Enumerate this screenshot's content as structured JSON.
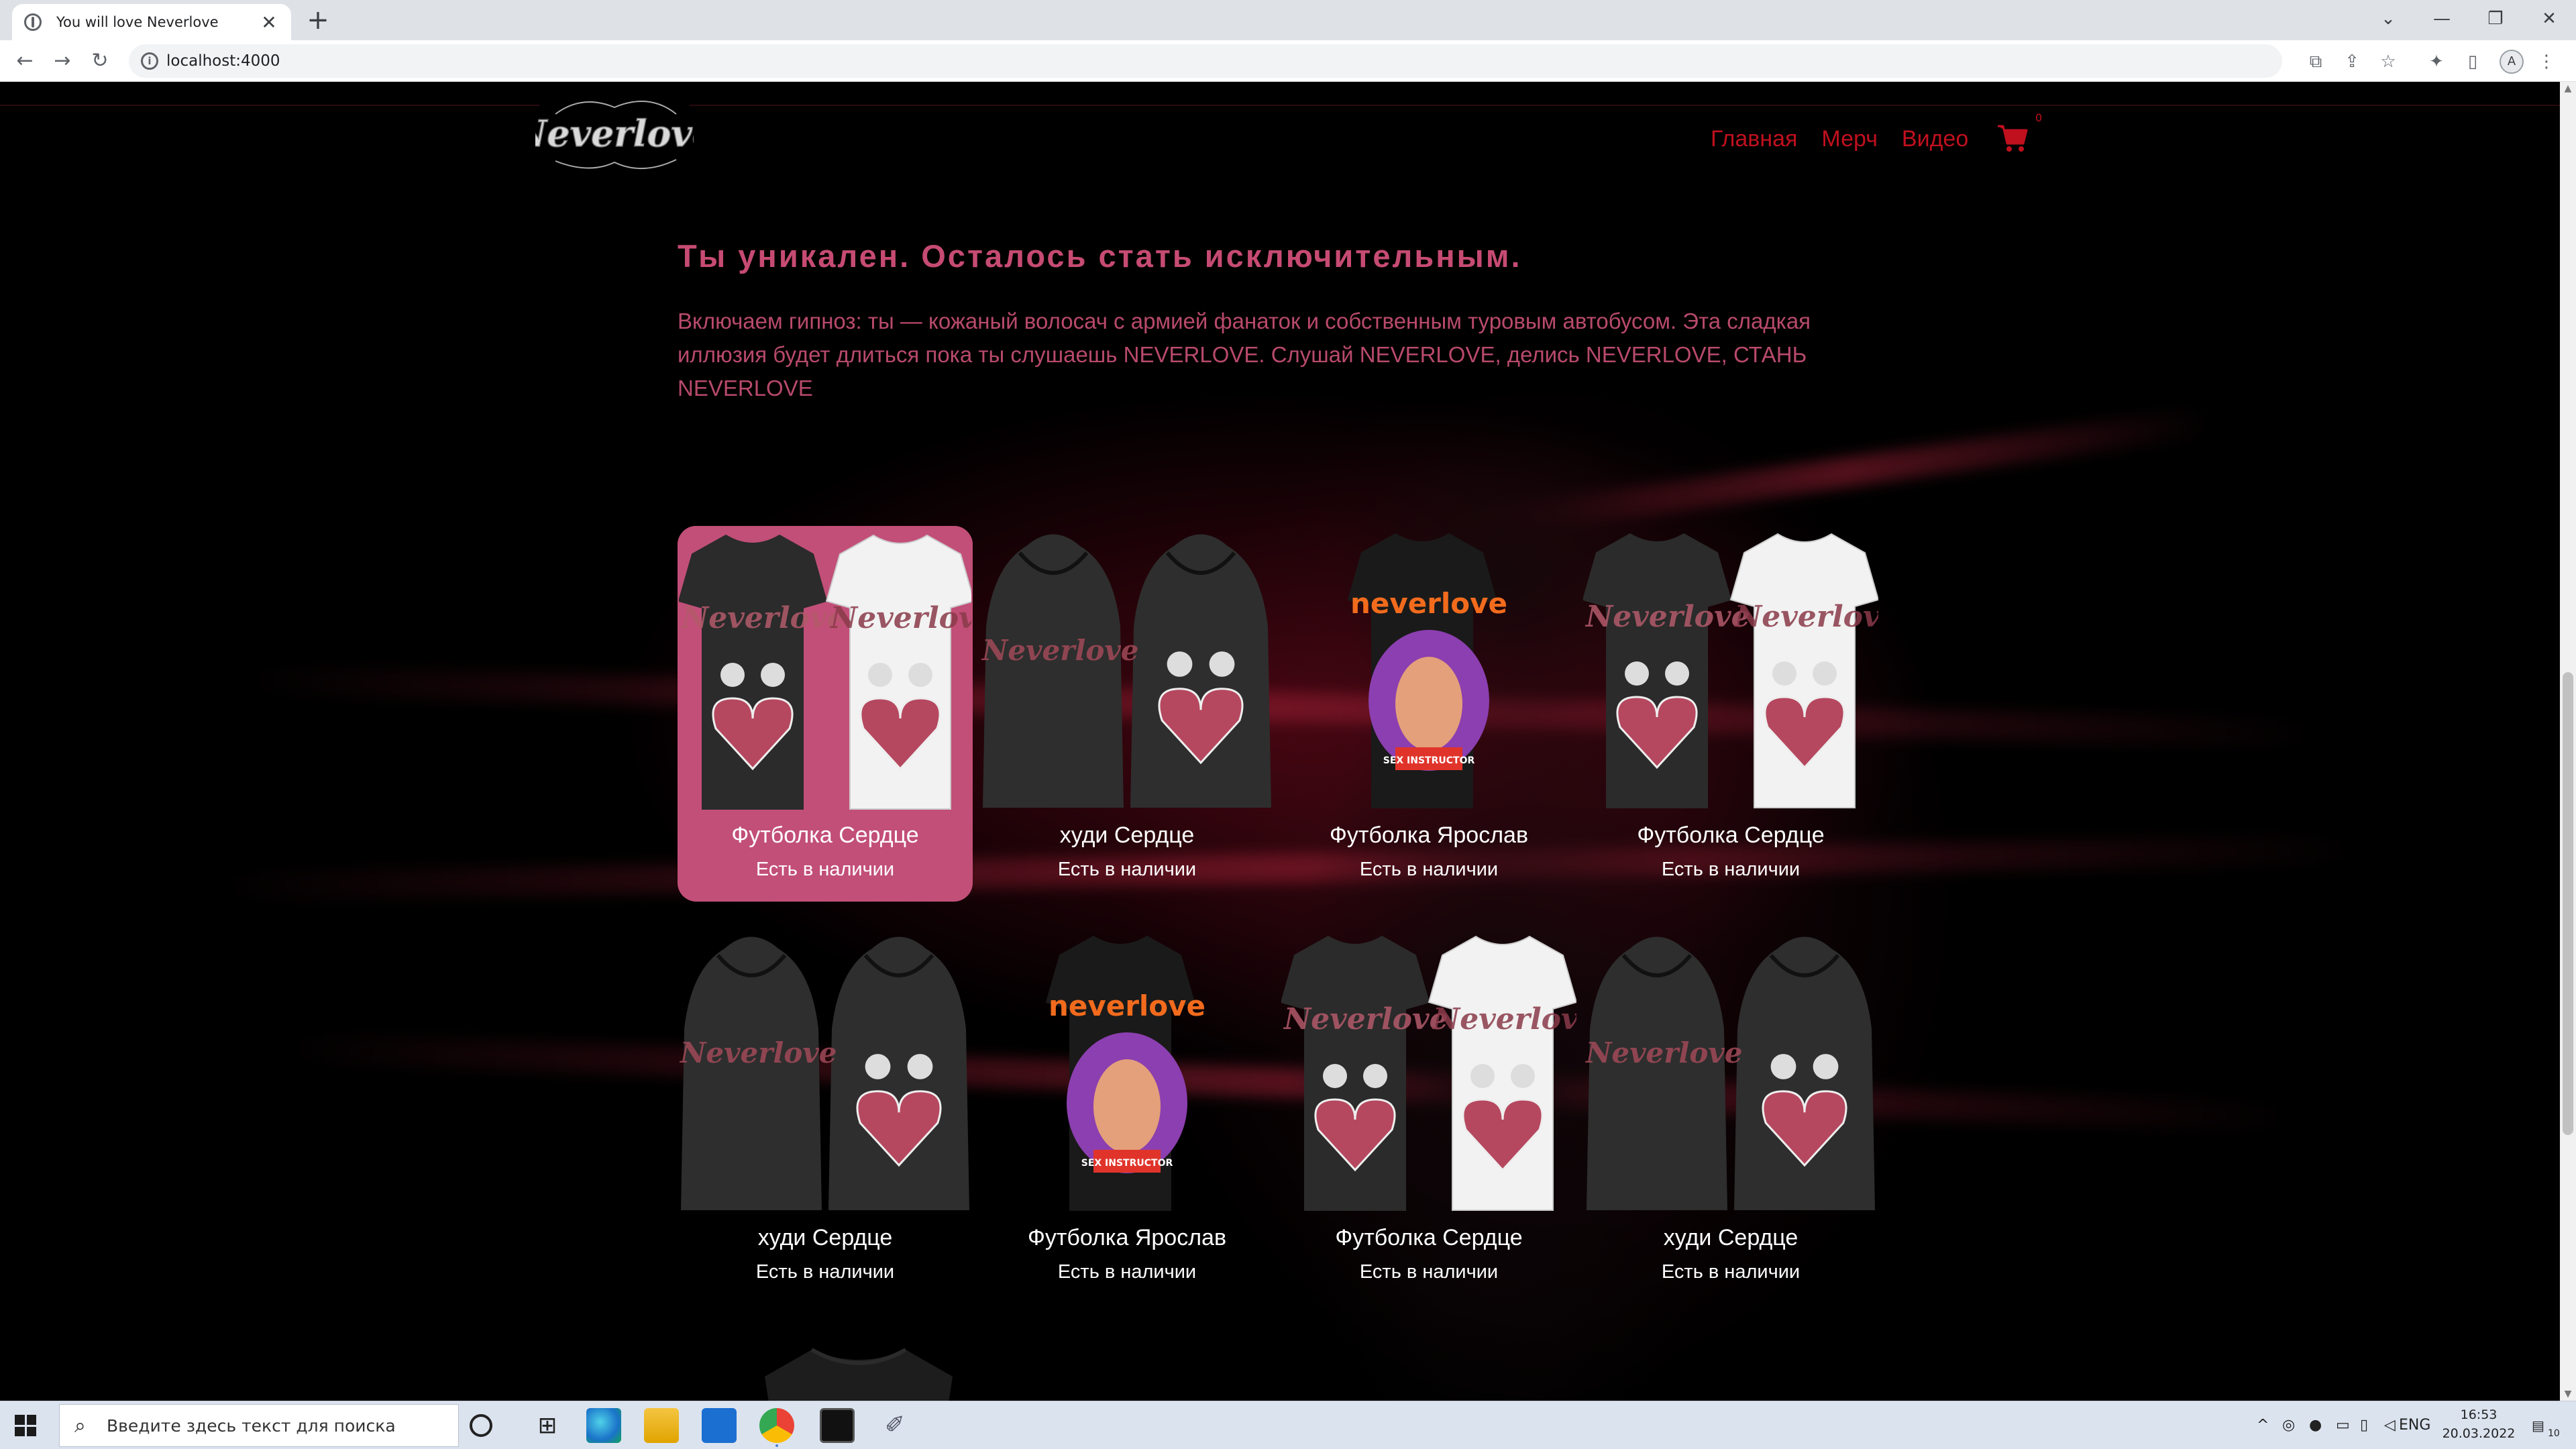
{
  "browser": {
    "tab_title": "You will love Neverlove",
    "tab_close": "✕",
    "new_tab": "+",
    "url": "localhost:4000",
    "profile_initial": "A",
    "window_controls": [
      "⌄",
      "—",
      "❐",
      "✕"
    ]
  },
  "site": {
    "logo_text": "Neverlove",
    "nav": [
      "Главная",
      "Мерч",
      "Видео"
    ],
    "cart_count": "0",
    "headline": "Ты уникален. Осталось стать исключительным.",
    "lead": "Включаем гипноз: ты — кожаный волосач с армией фанаток и собственным туровым автобусом. Эта сладкая иллюзия будет длиться пока ты слушаешь NEVERLOVE. Слушай NEVERLOVE, делись NEVERLOVE, СТАНЬ NEVERLOVE",
    "products": [
      {
        "name": "Футболка Сердце",
        "stock": "Есть в наличии",
        "kind": "tee-pair",
        "active": true
      },
      {
        "name": "худи Сердце",
        "stock": "Есть в наличии",
        "kind": "hoodie-pair",
        "active": false
      },
      {
        "name": "Футболка Ярослав",
        "stock": "Есть в наличии",
        "kind": "tee-portrait",
        "active": false
      },
      {
        "name": "Футболка Сердце",
        "stock": "Есть в наличии",
        "kind": "tee-pair",
        "active": false
      },
      {
        "name": "худи Сердце",
        "stock": "Есть в наличии",
        "kind": "hoodie-pair",
        "active": false
      },
      {
        "name": "Футболка Ярослав",
        "stock": "Есть в наличии",
        "kind": "tee-portrait",
        "active": false
      },
      {
        "name": "Футболка Сердце",
        "stock": "Есть в наличии",
        "kind": "tee-pair",
        "active": false
      },
      {
        "name": "худи Сердце",
        "stock": "Есть в наличии",
        "kind": "hoodie-pair",
        "active": false
      }
    ],
    "portrait_print": "neverlove",
    "portrait_caption": "SEX INSTRUCTOR"
  },
  "taskbar": {
    "search_placeholder": "Введите здесь текст для поиска",
    "lang": "ENG",
    "time": "16:53",
    "date": "20.03.2022",
    "notif_count": "10"
  },
  "colors": {
    "accent_pink": "#c24f78",
    "nav_red": "#c0101e",
    "headline_pink": "#c64b72"
  }
}
